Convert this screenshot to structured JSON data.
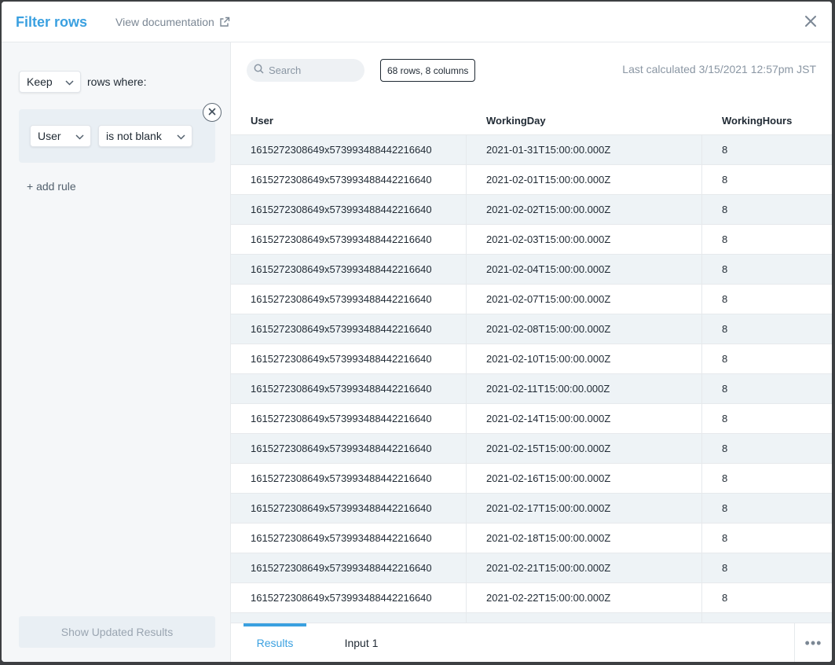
{
  "header": {
    "title": "Filter rows",
    "doc_link": "View documentation"
  },
  "left": {
    "mode_value": "Keep",
    "rows_where": "rows where:",
    "rule": {
      "column": "User",
      "operator": "is not blank"
    },
    "add_rule": "+ add rule",
    "update_button": "Show Updated Results"
  },
  "right": {
    "search_placeholder": "Search",
    "count_badge": "68 rows, 8 columns",
    "last_calculated": "Last calculated 3/15/2021 12:57pm JST",
    "columns": [
      "User",
      "WorkingDay",
      "WorkingHours"
    ],
    "rows": [
      [
        "1615272308649x573993488442216640",
        "2021-01-31T15:00:00.000Z",
        "8"
      ],
      [
        "1615272308649x573993488442216640",
        "2021-02-01T15:00:00.000Z",
        "8"
      ],
      [
        "1615272308649x573993488442216640",
        "2021-02-02T15:00:00.000Z",
        "8"
      ],
      [
        "1615272308649x573993488442216640",
        "2021-02-03T15:00:00.000Z",
        "8"
      ],
      [
        "1615272308649x573993488442216640",
        "2021-02-04T15:00:00.000Z",
        "8"
      ],
      [
        "1615272308649x573993488442216640",
        "2021-02-07T15:00:00.000Z",
        "8"
      ],
      [
        "1615272308649x573993488442216640",
        "2021-02-08T15:00:00.000Z",
        "8"
      ],
      [
        "1615272308649x573993488442216640",
        "2021-02-10T15:00:00.000Z",
        "8"
      ],
      [
        "1615272308649x573993488442216640",
        "2021-02-11T15:00:00.000Z",
        "8"
      ],
      [
        "1615272308649x573993488442216640",
        "2021-02-14T15:00:00.000Z",
        "8"
      ],
      [
        "1615272308649x573993488442216640",
        "2021-02-15T15:00:00.000Z",
        "8"
      ],
      [
        "1615272308649x573993488442216640",
        "2021-02-16T15:00:00.000Z",
        "8"
      ],
      [
        "1615272308649x573993488442216640",
        "2021-02-17T15:00:00.000Z",
        "8"
      ],
      [
        "1615272308649x573993488442216640",
        "2021-02-18T15:00:00.000Z",
        "8"
      ],
      [
        "1615272308649x573993488442216640",
        "2021-02-21T15:00:00.000Z",
        "8"
      ],
      [
        "1615272308649x573993488442216640",
        "2021-02-22T15:00:00.000Z",
        "8"
      ],
      [
        "",
        "",
        ""
      ]
    ]
  },
  "footer": {
    "tabs": [
      "Results",
      "Input 1"
    ],
    "active_tab": "Results",
    "more_label": "•••"
  },
  "colors": {
    "accent": "#3aa0e0",
    "row_stripe": "#eef3f6",
    "panel_bg": "#f5f7f9"
  }
}
